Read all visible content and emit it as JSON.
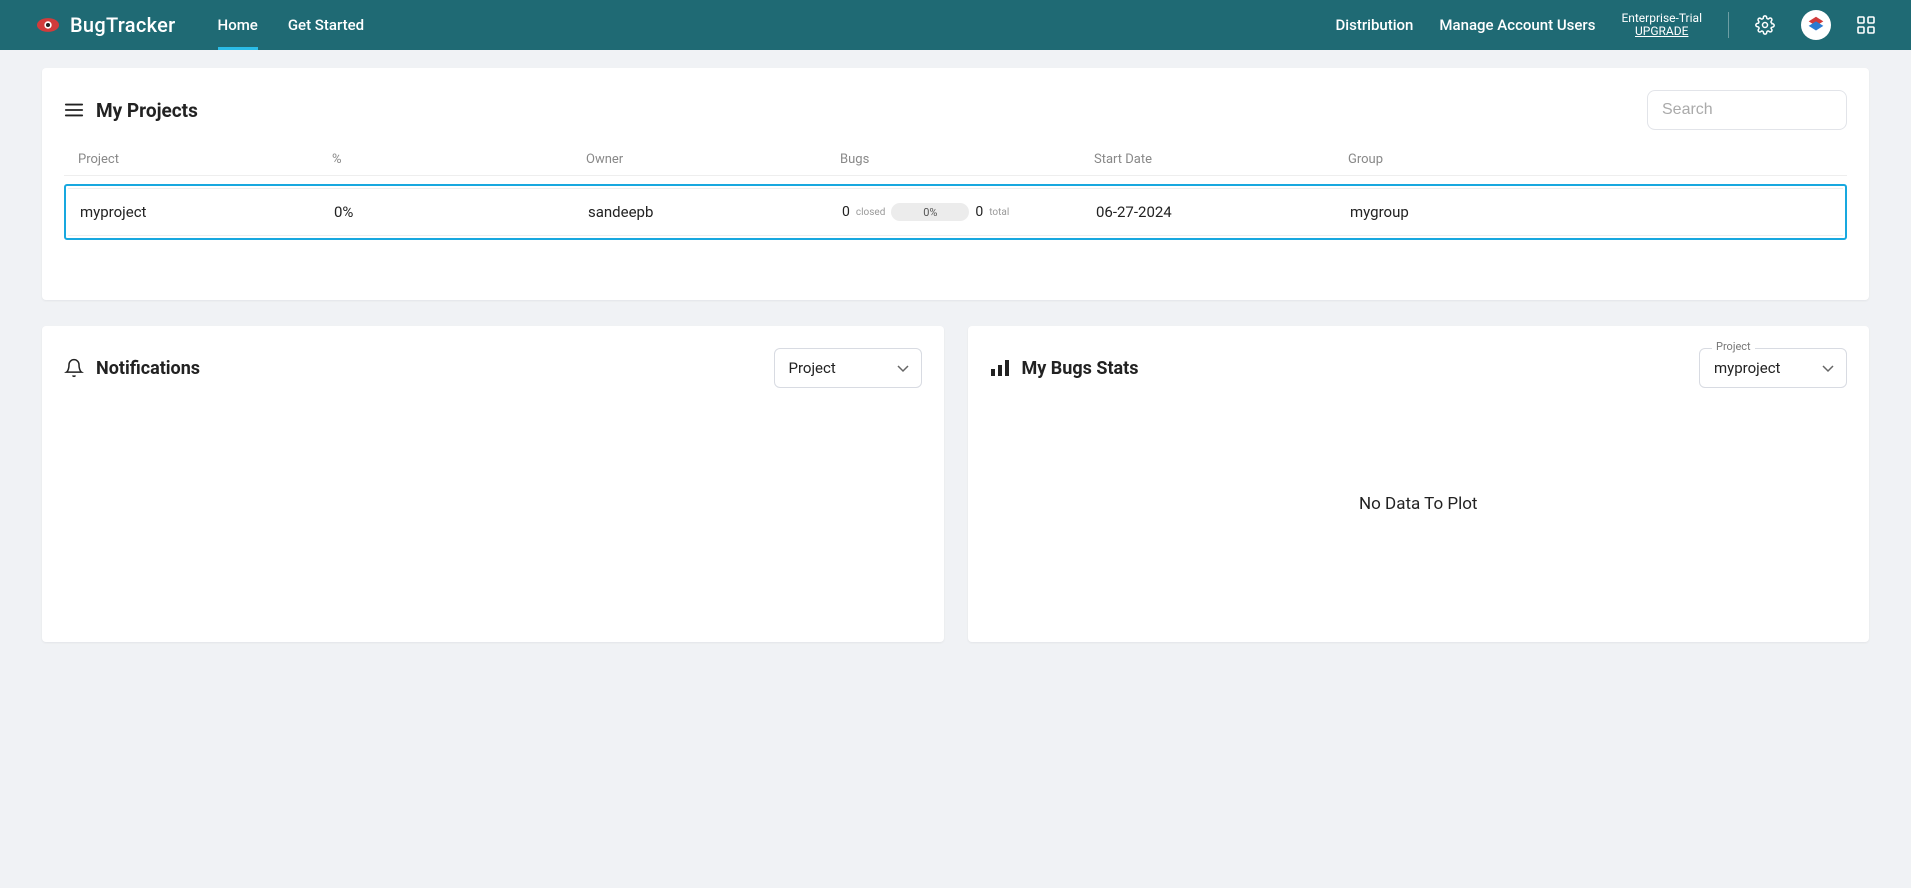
{
  "header": {
    "brand": "BugTracker",
    "nav": {
      "home": "Home",
      "getStarted": "Get Started"
    },
    "right": {
      "distribution": "Distribution",
      "manageUsers": "Manage Account Users",
      "planName": "Enterprise-Trial",
      "upgrade": "UPGRADE"
    }
  },
  "projects": {
    "title": "My Projects",
    "searchPlaceholder": "Search",
    "columns": {
      "project": "Project",
      "percent": "%",
      "owner": "Owner",
      "bugs": "Bugs",
      "startDate": "Start Date",
      "group": "Group"
    },
    "rows": [
      {
        "name": "myproject",
        "percent": "0%",
        "owner": "sandeepb",
        "bugsClosed": "0",
        "bugsClosedLabel": "closed",
        "bugsBar": "0%",
        "bugsTotal": "0",
        "bugsTotalLabel": "total",
        "startDate": "06-27-2024",
        "group": "mygroup"
      }
    ]
  },
  "notifications": {
    "title": "Notifications",
    "dropdown": "Project"
  },
  "stats": {
    "title": "My Bugs Stats",
    "dropdownLabel": "Project",
    "dropdownValue": "myproject",
    "noData": "No Data To Plot"
  }
}
